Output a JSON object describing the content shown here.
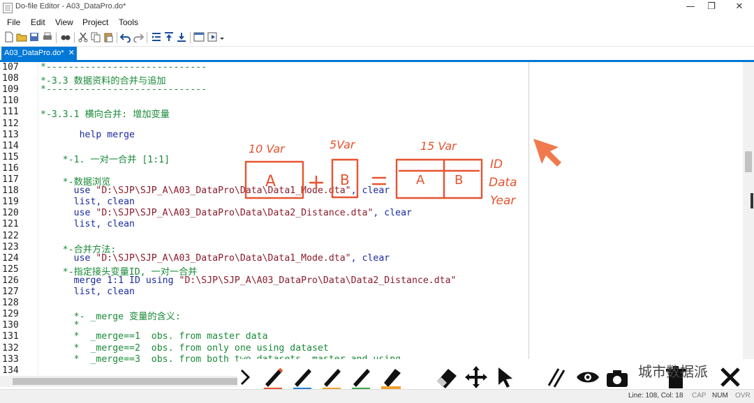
{
  "window": {
    "title": "Do-file Editor - A03_DataPro.do*",
    "controls": [
      "—",
      "❐",
      "✕"
    ]
  },
  "menu": [
    "File",
    "Edit",
    "View",
    "Project",
    "Tools"
  ],
  "tab": {
    "label": "A03_DataPro.do*",
    "close": "✕"
  },
  "lines": [
    {
      "n": "107",
      "parts": [
        [
          "c-cmt",
          "*-----------------------------"
        ]
      ]
    },
    {
      "n": "108",
      "parts": [
        [
          "c-cmt",
          "*-3.3 数据资料的合并与追加"
        ]
      ]
    },
    {
      "n": "109",
      "parts": [
        [
          "c-cmt",
          "*-----------------------------"
        ]
      ]
    },
    {
      "n": "110",
      "parts": []
    },
    {
      "n": "111",
      "parts": [
        [
          "c-cmt",
          "*-3.3.1 横向合并: 增加变量"
        ]
      ]
    },
    {
      "n": "112",
      "parts": []
    },
    {
      "n": "113",
      "parts": [
        [
          "c-plain",
          "       help merge"
        ]
      ]
    },
    {
      "n": "114",
      "parts": []
    },
    {
      "n": "115",
      "parts": [
        [
          "c-cmt",
          "    *-1. 一对一合并 [1:1]"
        ]
      ]
    },
    {
      "n": "116",
      "parts": []
    },
    {
      "n": "117",
      "parts": [
        [
          "c-cmt",
          "    *-数据浏览"
        ]
      ]
    },
    {
      "n": "118",
      "parts": [
        [
          "c-plain",
          "      use "
        ],
        [
          "c-str",
          "\"D:\\SJP\\SJP_A\\A03_DataPro\\Data\\Data1_Mode.dta\""
        ],
        [
          "c-plain",
          ", "
        ],
        [
          "c-kw",
          "clear"
        ]
      ]
    },
    {
      "n": "119",
      "parts": [
        [
          "c-plain",
          "      list, clean"
        ]
      ]
    },
    {
      "n": "120",
      "parts": [
        [
          "c-plain",
          "      use "
        ],
        [
          "c-str",
          "\"D:\\SJP\\SJP_A\\A03_DataPro\\Data\\Data2_Distance.dta\""
        ],
        [
          "c-plain",
          ", "
        ],
        [
          "c-kw",
          "clear"
        ]
      ]
    },
    {
      "n": "121",
      "parts": [
        [
          "c-plain",
          "      list, clean"
        ]
      ]
    },
    {
      "n": "122",
      "parts": []
    },
    {
      "n": "123",
      "parts": [
        [
          "c-cmt",
          "    *-合并方法:"
        ]
      ]
    },
    {
      "n": "124",
      "parts": [
        [
          "c-plain",
          "      use "
        ],
        [
          "c-str",
          "\"D:\\SJP\\SJP_A\\A03_DataPro\\Data\\Data1_Mode.dta\""
        ],
        [
          "c-plain",
          ", "
        ],
        [
          "c-kw",
          "clear"
        ]
      ]
    },
    {
      "n": "125",
      "parts": [
        [
          "c-cmt",
          "    *-指定接头变量ID, 一对一合并"
        ]
      ]
    },
    {
      "n": "126",
      "parts": [
        [
          "c-plain",
          "      merge 1:1 ID using "
        ],
        [
          "c-str",
          "\"D:\\SJP\\SJP_A\\A03_DataPro\\Data\\Data2_Distance.dta\""
        ]
      ]
    },
    {
      "n": "127",
      "parts": [
        [
          "c-plain",
          "      list, clean"
        ]
      ]
    },
    {
      "n": "128",
      "parts": []
    },
    {
      "n": "129",
      "parts": [
        [
          "c-cmt",
          "      *- _merge 变量的含义:"
        ]
      ]
    },
    {
      "n": "130",
      "parts": [
        [
          "c-cmt",
          "      *"
        ]
      ]
    },
    {
      "n": "131",
      "parts": [
        [
          "c-cmt",
          "      *  _merge==1  obs. from master data"
        ]
      ]
    },
    {
      "n": "132",
      "parts": [
        [
          "c-cmt",
          "      *  _merge==2  obs. from only one using dataset"
        ]
      ]
    },
    {
      "n": "133",
      "parts": [
        [
          "c-cmt",
          "      *  _merge==3  obs. from both two datasets, master and using"
        ]
      ]
    },
    {
      "n": "134",
      "parts": []
    }
  ],
  "annotation": {
    "left_label": "10 Var",
    "mid_label": "5Var",
    "right_label": "15 Var",
    "box_a": "A",
    "box_b": "B",
    "plus": "+",
    "equals": "=",
    "merged_a": "A",
    "merged_b": "B",
    "side_words": [
      "ID",
      "Data",
      "Year"
    ],
    "color": "#e8532f"
  },
  "status": {
    "position": "Line: 108, Col: 18",
    "cap": "CAP",
    "num": "NUM",
    "ovr": "OVR"
  },
  "watermark": "城市数据派",
  "draw_tools": [
    "chevron-right-icon",
    "pen-red-icon",
    "pen-blue-icon",
    "pen-orange-icon",
    "pen-green-icon",
    "highlighter-orange-icon",
    "eraser-icon",
    "move-icon",
    "pointer-icon",
    "lines-icon",
    "eye-icon",
    "camera-icon",
    "trash-icon",
    "close-icon"
  ]
}
